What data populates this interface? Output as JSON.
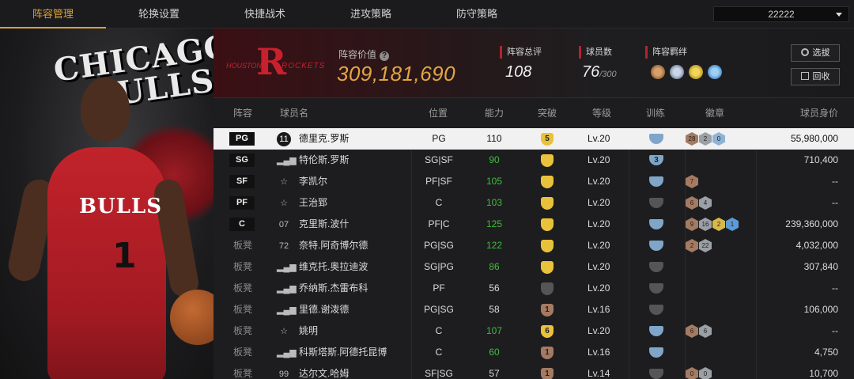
{
  "nav": {
    "tabs": [
      {
        "label": "阵容管理",
        "active": true
      },
      {
        "label": "轮换设置",
        "active": false
      },
      {
        "label": "快捷战术",
        "active": false
      },
      {
        "label": "进攻策略",
        "active": false
      },
      {
        "label": "防守策略",
        "active": false
      }
    ],
    "account_id": "22222"
  },
  "left_art": {
    "team_text_line1": "CHICAGO",
    "team_text_line2": "BULLS",
    "jersey_text": "BULLS",
    "jersey_number": "1"
  },
  "team_header": {
    "logo_mark": "R",
    "logo_left_text": "HOUSTON",
    "logo_right_text": "ROCKETS",
    "value_label": "阵容价值",
    "value": "309,181,690",
    "overall_label": "阵容总评",
    "overall_value": "108",
    "player_count_label": "球员数",
    "player_count_value": "76",
    "player_count_max": "/300",
    "bonds_label": "阵容羁绊",
    "bond_icons": [
      "bond-icon-1",
      "bond-icon-2",
      "bond-icon-3",
      "bond-icon-4"
    ],
    "btn_draft": "选拔",
    "btn_recycle": "回收"
  },
  "table": {
    "columns": [
      "阵容",
      "球员名",
      "位置",
      "能力",
      "突破",
      "等级",
      "训练",
      "徽章",
      "球员身价"
    ],
    "rows": [
      {
        "slot": "PG",
        "starter": true,
        "icon": "11",
        "name": "德里克.罗斯",
        "pos": "PG",
        "ability": "110",
        "green": false,
        "break": "5",
        "break_color": "#e9c23b",
        "level": "Lv.20",
        "train": "",
        "train_color": "#7fa6c8",
        "badges": [
          {
            "t": "28",
            "c": "#a47a62"
          },
          {
            "t": "2",
            "c": "#9aa0a6"
          },
          {
            "t": "0",
            "c": "#8fb3d6"
          }
        ],
        "salary": "55,980,000"
      },
      {
        "slot": "SG",
        "starter": true,
        "icon": "bars",
        "name": "特伦斯.罗斯",
        "pos": "SG|SF",
        "ability": "90",
        "green": true,
        "break": "",
        "break_color": "#e9c23b",
        "level": "Lv.20",
        "train": "3",
        "train_color": "#7fa6c8",
        "badges": [],
        "salary": "710,400"
      },
      {
        "slot": "SF",
        "starter": true,
        "icon": "star",
        "name": "李凯尔",
        "pos": "PF|SF",
        "ability": "105",
        "green": true,
        "break": "",
        "break_color": "#e9c23b",
        "level": "Lv.20",
        "train": "",
        "train_color": "#7fa6c8",
        "badges": [
          {
            "t": "7",
            "c": "#a47a62"
          }
        ],
        "salary": "--"
      },
      {
        "slot": "PF",
        "starter": true,
        "icon": "star",
        "name": "王治郅",
        "pos": "C",
        "ability": "103",
        "green": true,
        "break": "",
        "break_color": "#e9c23b",
        "level": "Lv.20",
        "train": "",
        "train_color": "#555",
        "badges": [
          {
            "t": "6",
            "c": "#a47a62"
          },
          {
            "t": "4",
            "c": "#9aa0a6"
          }
        ],
        "salary": "--"
      },
      {
        "slot": "C",
        "starter": true,
        "icon": "07",
        "name": "克里斯.波什",
        "pos": "PF|C",
        "ability": "125",
        "green": true,
        "break": "",
        "break_color": "#e9c23b",
        "level": "Lv.20",
        "train": "",
        "train_color": "#7fa6c8",
        "badges": [
          {
            "t": "9",
            "c": "#a47a62"
          },
          {
            "t": "16",
            "c": "#9aa0a6"
          },
          {
            "t": "2",
            "c": "#d8b84a"
          },
          {
            "t": "1",
            "c": "#5d9bd6"
          }
        ],
        "salary": "239,360,000"
      },
      {
        "slot": "板凳",
        "starter": false,
        "icon": "72",
        "name": "奈特.阿奇博尔德",
        "pos": "PG|SG",
        "ability": "122",
        "green": true,
        "break": "",
        "break_color": "#e9c23b",
        "level": "Lv.20",
        "train": "",
        "train_color": "#7fa6c8",
        "badges": [
          {
            "t": "2",
            "c": "#a47a62"
          },
          {
            "t": "22",
            "c": "#9aa0a6"
          }
        ],
        "salary": "4,032,000"
      },
      {
        "slot": "板凳",
        "starter": false,
        "icon": "bars",
        "name": "维克托.奥拉迪波",
        "pos": "SG|PG",
        "ability": "86",
        "green": true,
        "break": "",
        "break_color": "#e9c23b",
        "level": "Lv.20",
        "train": "",
        "train_color": "#555",
        "badges": [],
        "salary": "307,840"
      },
      {
        "slot": "板凳",
        "starter": false,
        "icon": "bars",
        "name": "乔纳斯.杰雷布科",
        "pos": "PF",
        "ability": "56",
        "green": false,
        "break": "",
        "break_color": "#555",
        "level": "Lv.20",
        "train": "",
        "train_color": "#555",
        "badges": [],
        "salary": "--"
      },
      {
        "slot": "板凳",
        "starter": false,
        "icon": "bars",
        "name": "里德.谢泼德",
        "pos": "PG|SG",
        "ability": "58",
        "green": false,
        "break": "1",
        "break_color": "#a47a62",
        "level": "Lv.16",
        "train": "",
        "train_color": "#555",
        "badges": [],
        "salary": "106,000"
      },
      {
        "slot": "板凳",
        "starter": false,
        "icon": "star",
        "name": "姚明",
        "pos": "C",
        "ability": "107",
        "green": true,
        "break": "6",
        "break_color": "#e9c23b",
        "level": "Lv.20",
        "train": "",
        "train_color": "#7fa6c8",
        "badges": [
          {
            "t": "6",
            "c": "#a47a62"
          },
          {
            "t": "6",
            "c": "#9aa0a6"
          }
        ],
        "salary": "--"
      },
      {
        "slot": "板凳",
        "starter": false,
        "icon": "bars",
        "name": "科斯塔斯.阿德托昆博",
        "pos": "C",
        "ability": "60",
        "green": true,
        "break": "1",
        "break_color": "#a47a62",
        "level": "Lv.16",
        "train": "",
        "train_color": "#7fa6c8",
        "badges": [],
        "salary": "4,750"
      },
      {
        "slot": "板凳",
        "starter": false,
        "icon": "99",
        "name": "达尔文.哈姆",
        "pos": "SF|SG",
        "ability": "57",
        "green": false,
        "break": "1",
        "break_color": "#a47a62",
        "level": "Lv.14",
        "train": "",
        "train_color": "#555",
        "badges": [
          {
            "t": "0",
            "c": "#a47a62"
          },
          {
            "t": "0",
            "c": "#9aa0a6"
          }
        ],
        "salary": "10,700"
      }
    ]
  }
}
